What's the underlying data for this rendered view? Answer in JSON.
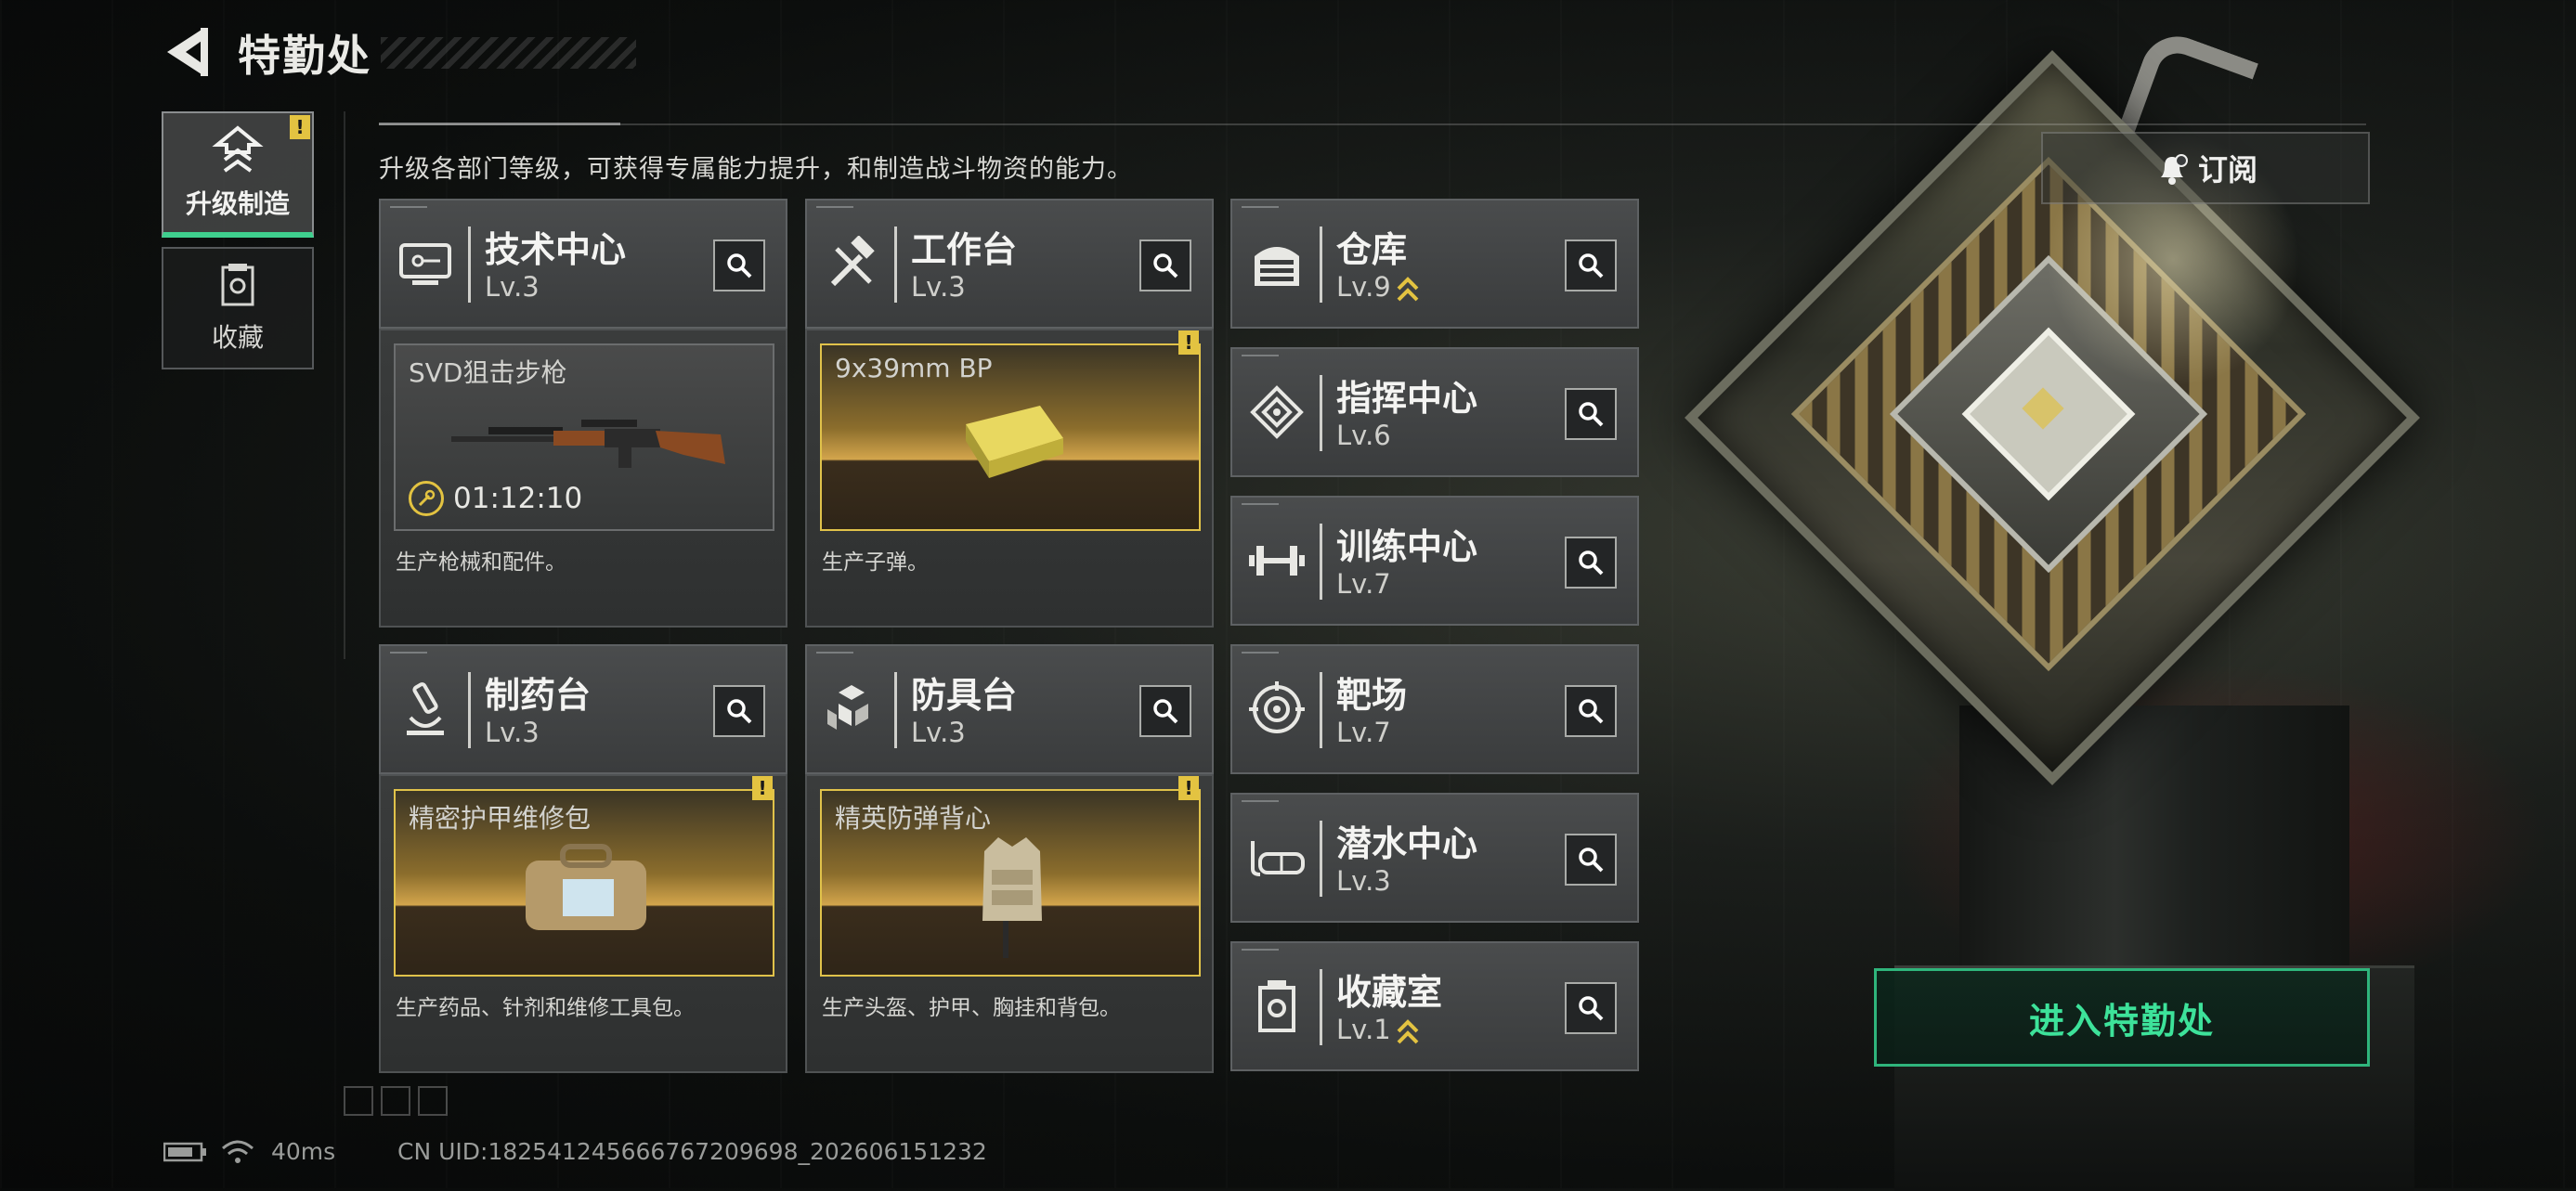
{
  "header": {
    "title": "特勤处"
  },
  "nav": [
    {
      "label": "升级制造",
      "icon": "upgrade-icon",
      "active": true,
      "alert": "!"
    },
    {
      "label": "收藏",
      "icon": "collection-icon",
      "active": false
    }
  ],
  "subtitle": "升级各部门等级，可获得专属能力提升，和制造战斗物资的能力。",
  "facilities": [
    {
      "name": "技术中心",
      "level": "Lv.3",
      "icon": "tech-center-icon"
    },
    {
      "name": "工作台",
      "level": "Lv.3",
      "icon": "workbench-icon"
    },
    {
      "name": "仓库",
      "level": "Lv.9",
      "icon": "warehouse-icon",
      "upgradable": true
    },
    {
      "name": "指挥中心",
      "level": "Lv.6",
      "icon": "command-center-icon"
    },
    {
      "name": "训练中心",
      "level": "Lv.7",
      "icon": "training-center-icon"
    },
    {
      "name": "制药台",
      "level": "Lv.3",
      "icon": "pharmacy-icon"
    },
    {
      "name": "防具台",
      "level": "Lv.3",
      "icon": "armor-bench-icon"
    },
    {
      "name": "靶场",
      "level": "Lv.7",
      "icon": "shooting-range-icon"
    },
    {
      "name": "潜水中心",
      "level": "Lv.3",
      "icon": "diving-center-icon"
    },
    {
      "name": "收藏室",
      "level": "Lv.1",
      "icon": "collection-room-icon",
      "upgradable": true
    }
  ],
  "production": [
    {
      "item": "SVD狙击步枪",
      "timer": "01:12:10",
      "desc": "生产枪械和配件。",
      "state": "in-progress"
    },
    {
      "item": "9x39mm BP",
      "desc": "生产子弹。",
      "state": "ready",
      "alert": "!"
    },
    {
      "item": "精密护甲维修包",
      "desc": "生产药品、针剂和维修工具包。",
      "state": "ready",
      "alert": "!"
    },
    {
      "item": "精英防弹背心",
      "desc": "生产头盔、护甲、胸挂和背包。",
      "state": "ready",
      "alert": "!"
    }
  ],
  "subscribe_label": "订阅",
  "enter_label": "进入特勤处",
  "status": {
    "ping": "40ms",
    "uid": "CN UID:1825412456667672096​98_202606151232"
  },
  "colors": {
    "accent_green": "#3de29a",
    "alert_yellow": "#e3c341",
    "gold_frame": "#e0c24a"
  }
}
